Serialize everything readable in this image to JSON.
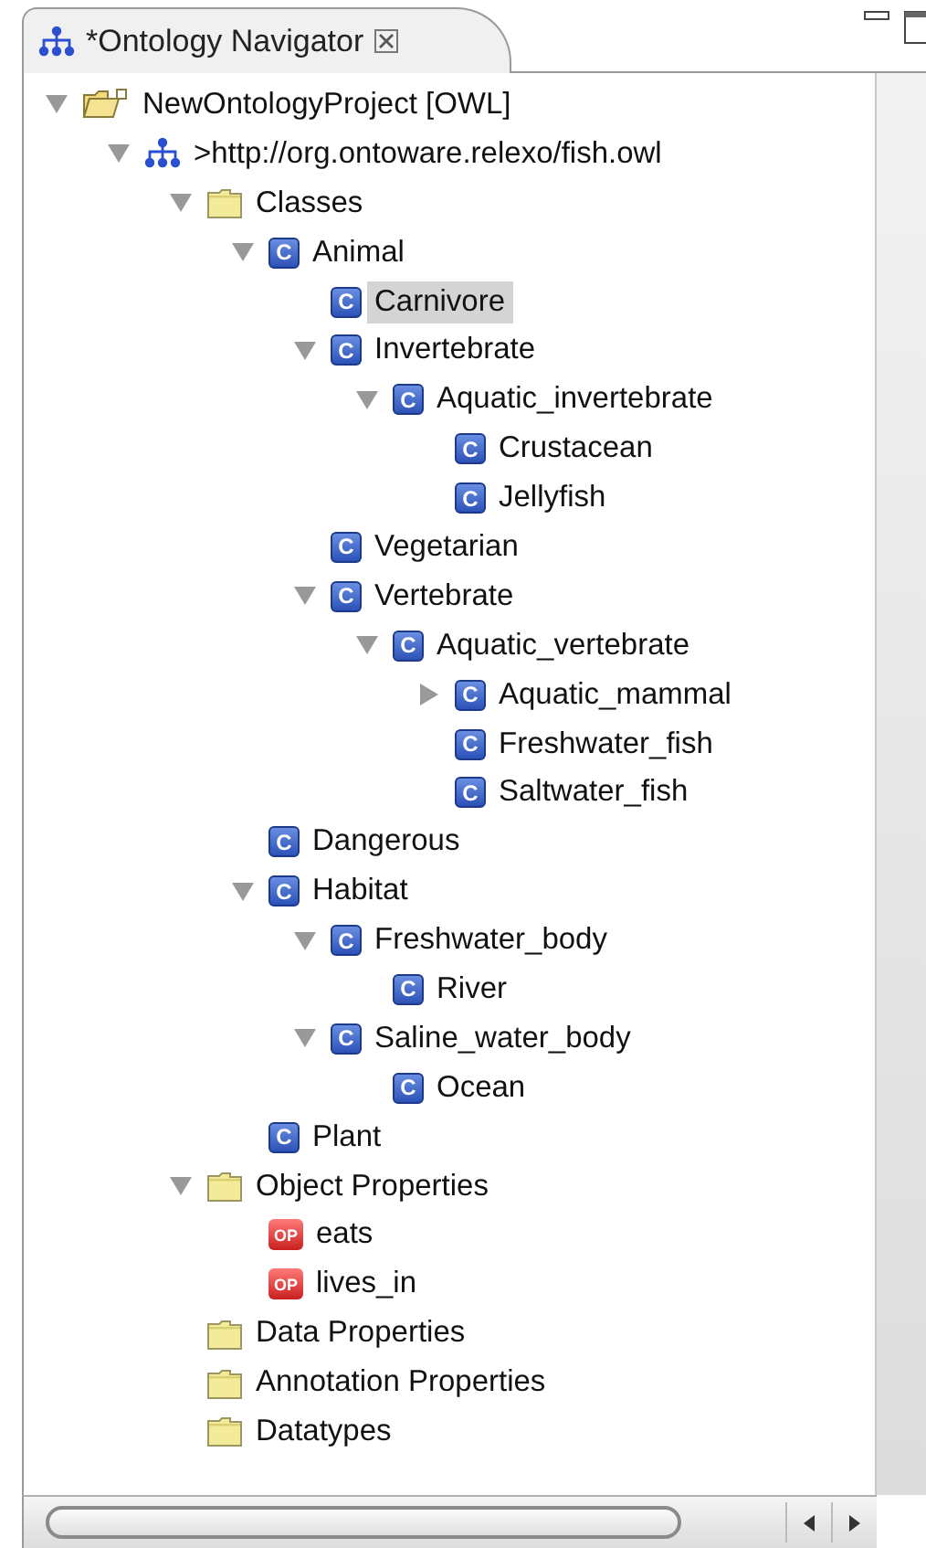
{
  "view": {
    "title": "*Ontology Navigator"
  },
  "tree": [
    {
      "label": "NewOntologyProject [OWL]",
      "kind": "project",
      "expanded": true,
      "selected": false,
      "children": [
        {
          "label": ">http://org.ontoware.relexo/fish.owl",
          "kind": "ontology",
          "expanded": true,
          "selected": false,
          "children": [
            {
              "label": "Classes",
              "kind": "folder",
              "expanded": true,
              "selected": false,
              "children": [
                {
                  "label": "Animal",
                  "kind": "class",
                  "badge": "C",
                  "expanded": true,
                  "selected": false,
                  "children": [
                    {
                      "label": "Carnivore",
                      "kind": "class",
                      "badge": "C",
                      "selected": true
                    },
                    {
                      "label": "Invertebrate",
                      "kind": "class",
                      "badge": "C",
                      "expanded": true,
                      "selected": false,
                      "children": [
                        {
                          "label": "Aquatic_invertebrate",
                          "kind": "class",
                          "badge": "C",
                          "expanded": true,
                          "selected": false,
                          "children": [
                            {
                              "label": "Crustacean",
                              "kind": "class",
                              "badge": "C",
                              "selected": false
                            },
                            {
                              "label": "Jellyfish",
                              "kind": "class",
                              "badge": "C",
                              "selected": false
                            }
                          ]
                        }
                      ]
                    },
                    {
                      "label": "Vegetarian",
                      "kind": "class",
                      "badge": "C",
                      "selected": false
                    },
                    {
                      "label": "Vertebrate",
                      "kind": "class",
                      "badge": "C",
                      "expanded": true,
                      "selected": false,
                      "children": [
                        {
                          "label": "Aquatic_vertebrate",
                          "kind": "class",
                          "badge": "C",
                          "expanded": true,
                          "selected": false,
                          "children": [
                            {
                              "label": "Aquatic_mammal",
                              "kind": "class",
                              "badge": "C",
                              "expanded": false,
                              "selected": false
                            },
                            {
                              "label": "Freshwater_fish",
                              "kind": "class",
                              "badge": "C",
                              "selected": false
                            },
                            {
                              "label": "Saltwater_fish",
                              "kind": "class",
                              "badge": "C",
                              "selected": false
                            }
                          ]
                        }
                      ]
                    }
                  ]
                },
                {
                  "label": "Dangerous",
                  "kind": "class",
                  "badge": "C",
                  "selected": false
                },
                {
                  "label": "Habitat",
                  "kind": "class",
                  "badge": "C",
                  "expanded": true,
                  "selected": false,
                  "children": [
                    {
                      "label": "Freshwater_body",
                      "kind": "class",
                      "badge": "C",
                      "expanded": true,
                      "selected": false,
                      "children": [
                        {
                          "label": "River",
                          "kind": "class",
                          "badge": "C",
                          "selected": false
                        }
                      ]
                    },
                    {
                      "label": "Saline_water_body",
                      "kind": "class",
                      "badge": "C",
                      "expanded": true,
                      "selected": false,
                      "children": [
                        {
                          "label": "Ocean",
                          "kind": "class",
                          "badge": "C",
                          "selected": false
                        }
                      ]
                    }
                  ]
                },
                {
                  "label": "Plant",
                  "kind": "class",
                  "badge": "C",
                  "selected": false
                }
              ]
            },
            {
              "label": "Object Properties",
              "kind": "folder",
              "expanded": true,
              "selected": false,
              "children": [
                {
                  "label": "eats",
                  "kind": "property",
                  "badge": "OP",
                  "selected": false
                },
                {
                  "label": "lives_in",
                  "kind": "property",
                  "badge": "OP",
                  "selected": false
                }
              ]
            },
            {
              "label": "Data Properties",
              "kind": "folder",
              "selected": false
            },
            {
              "label": "Annotation Properties",
              "kind": "folder",
              "selected": false
            },
            {
              "label": "Datatypes",
              "kind": "folder",
              "selected": false
            }
          ]
        }
      ]
    }
  ]
}
